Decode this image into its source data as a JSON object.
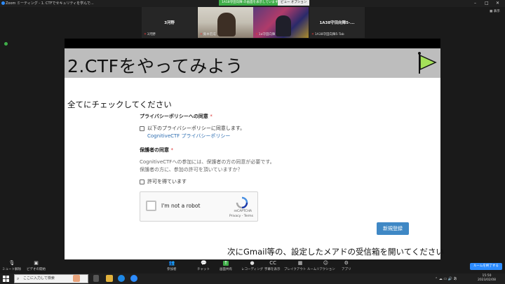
{
  "window": {
    "app_title": "Zoom ミーティング - 1. CTFでセキュリティを学んで...",
    "share_banner": "1A18守田向陣 の画面を表示しています",
    "view_options": "ビュー オプション",
    "view_label": "表示"
  },
  "participants": [
    {
      "display_name": "3河野",
      "label": "3河野",
      "video": false
    },
    {
      "display_name": "",
      "label": "集本宏成",
      "video": true
    },
    {
      "display_name": "",
      "label": "1a守田向陣",
      "video": true
    },
    {
      "display_name": "1A38守田向陣5-...",
      "label": "1A38守田向陣5-Tab",
      "video": false
    }
  ],
  "slide": {
    "title": "2.CTFをやってみよう",
    "check_heading": "全てにチェックしてください",
    "privacy_section": {
      "title": "プライバシーポリシーへの同意",
      "required_mark": "*",
      "checkbox_label": "以下のプライバシーポリシーに同意します。",
      "link_text": "CognitiveCTF プライバシーポリシー"
    },
    "guardian_section": {
      "title": "保護者の同意",
      "required_mark": "*",
      "line1": "CognitiveCTFへの参加には、保護者の方の同意が必要です。",
      "line2": "保護者の方に、参加の許可を頂いていますか？",
      "checkbox_label": "許可を得ています"
    },
    "recaptcha": {
      "label": "I'm not a robot",
      "brand": "reCAPTCHA",
      "terms": "Privacy - Terms"
    },
    "register_button": "新規登録",
    "bottom_note": "次にGmail等の、設定したメアドの受信箱を開いてください"
  },
  "toolbar": {
    "items": [
      {
        "label": "ミュート解除",
        "icon": "mic-muted-icon"
      },
      {
        "label": "ビデオの開始",
        "icon": "video-off-icon"
      },
      {
        "label": "参加者",
        "icon": "participants-icon",
        "badge": "4"
      },
      {
        "label": "チャット",
        "icon": "chat-icon"
      },
      {
        "label": "画面共有",
        "icon": "share-screen-icon"
      },
      {
        "label": "レコーディング",
        "icon": "record-icon"
      },
      {
        "label": "字幕を表示",
        "icon": "cc-icon"
      },
      {
        "label": "ブレイクアウト ルーム",
        "icon": "breakout-icon"
      },
      {
        "label": "リアクション",
        "icon": "reaction-icon"
      },
      {
        "label": "アプリ",
        "icon": "apps-icon"
      }
    ],
    "end_button": "ルームを終了する"
  },
  "taskbar": {
    "search_placeholder": "ここに入力して検索",
    "time": "15:50",
    "date": "2023/02/08"
  },
  "colors": {
    "slide_header_bg": "#bdbdbd",
    "link": "#2b6cb0",
    "primary_button": "#3f88c5",
    "share_green": "#3fae49",
    "zoom_blue": "#2d8cff"
  }
}
